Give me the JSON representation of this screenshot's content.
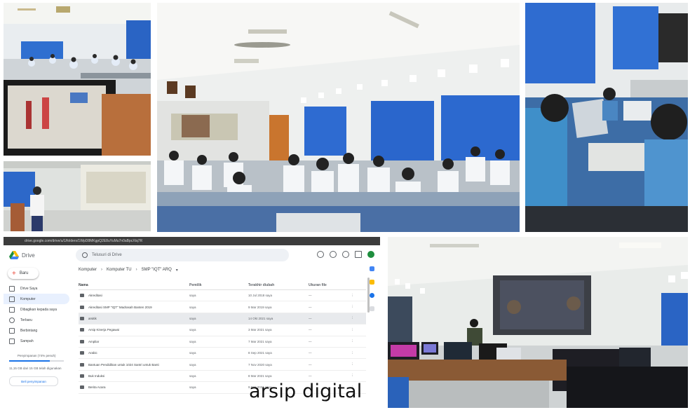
{
  "drive": {
    "url_text": "drive.google.com/drive/u/1/folders/1WpD8MKgpQ2E8uYuMu7n0aBpcXtq7R",
    "brand": "Drive",
    "search_placeholder": "Telusuri di Drive",
    "new_button": "Baru",
    "sidebar": [
      {
        "label": "Drive Saya",
        "icon": "drive-icon"
      },
      {
        "label": "Komputer",
        "icon": "computer-icon"
      },
      {
        "label": "Dibagikan kepada saya",
        "icon": "shared-icon"
      },
      {
        "label": "Terbaru",
        "icon": "clock-icon"
      },
      {
        "label": "Berbintang",
        "icon": "star-icon"
      },
      {
        "label": "Sampah",
        "icon": "trash-icon"
      }
    ],
    "storage_label": "Penyimpanan (74% penuh)",
    "storage_used": "11,15 GB dari 15 GB telah digunakan",
    "storage_fraction": 0.74,
    "buy_storage": "Beli penyimpanan",
    "breadcrumb": [
      "Komputer",
      "Komputer TU",
      "SMP \"IQT\" ARQ"
    ],
    "columns": {
      "name": "Nama",
      "owner": "Pemilik",
      "modified": "Terakhir diubah",
      "size": "Ukuran file"
    },
    "rows": [
      {
        "name": "Akreditasi",
        "owner": "saya",
        "modified": "10 Jul 2018 saya",
        "size": "—"
      },
      {
        "name": "Akreditasi SMP \"IQT\" Madrasah Banten 2019",
        "owner": "saya",
        "modified": "9 Mar 2019 saya",
        "size": "—"
      },
      {
        "name": "arsitik",
        "owner": "saya",
        "modified": "14 Okt 2021 saya",
        "size": "—",
        "selected": true
      },
      {
        "name": "Arsip Kinerja Pegawai",
        "owner": "saya",
        "modified": "3 Mar 2021 saya",
        "size": "—"
      },
      {
        "name": "Ampliar",
        "owner": "saya",
        "modified": "7 Mar 2021 saya",
        "size": "—"
      },
      {
        "name": "Arabic",
        "owner": "saya",
        "modified": "8 Sep 2021 saya",
        "size": "—"
      },
      {
        "name": "Bantuan Pendidikan untuk 1024 Santri untuk Banti",
        "owner": "saya",
        "modified": "7 Nov 2020 saya",
        "size": "—"
      },
      {
        "name": "Buk Induksi",
        "owner": "saya",
        "modified": "8 Mar 2021 saya",
        "size": "—"
      },
      {
        "name": "Berita Acara",
        "owner": "saya",
        "modified": "9 Mar 2021 saya",
        "size": "—"
      }
    ]
  },
  "caption": "arsip digital"
}
